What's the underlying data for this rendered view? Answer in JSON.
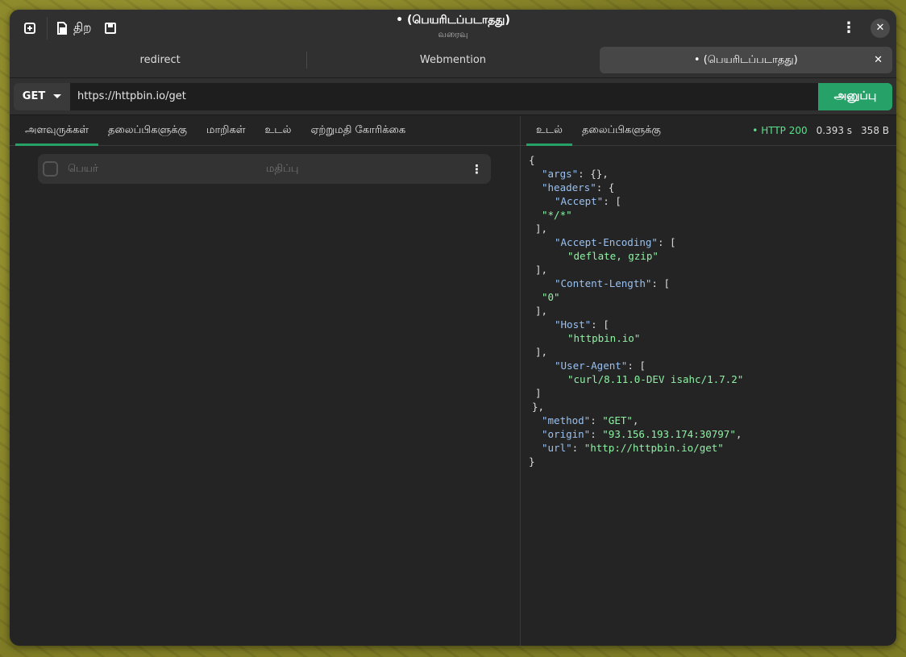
{
  "header": {
    "new_label": "",
    "open_label": "திற",
    "title": "• (பெயரிடப்படாதது)",
    "subtitle": "வரைவு"
  },
  "tabs": [
    {
      "label": "redirect",
      "active": false
    },
    {
      "label": "Webmention",
      "active": false
    },
    {
      "label": "• (பெயரிடப்படாதது)",
      "active": true
    }
  ],
  "request": {
    "method": "GET",
    "url": "https://httpbin.io/get",
    "send_label": "அனுப்பு"
  },
  "request_tabs": [
    "அளவுருக்கள்",
    "தலைப்பிகளுக்கு",
    "மாறிகள்",
    "உடல்",
    "ஏற்றுமதி கோரிக்கை"
  ],
  "params": {
    "name_placeholder": "பெயர்",
    "value_placeholder": "மதிப்பு"
  },
  "response_tabs": [
    "உடல்",
    "தலைப்பிகளுக்கு"
  ],
  "response": {
    "status": "• HTTP 200",
    "time": "0.393 s",
    "size": "358 B",
    "body_lines": [
      {
        "indent": 0,
        "parts": [
          [
            "p",
            "{"
          ]
        ]
      },
      {
        "indent": 2,
        "parts": [
          [
            "k",
            "\"args\""
          ],
          [
            "p",
            ": {},"
          ]
        ]
      },
      {
        "indent": 2,
        "parts": [
          [
            "k",
            "\"headers\""
          ],
          [
            "p",
            ": {"
          ]
        ]
      },
      {
        "indent": 4,
        "parts": [
          [
            "k",
            "\"Accept\""
          ],
          [
            "p",
            ": ["
          ]
        ]
      },
      {
        "indent": 2,
        "parts": [
          [
            "s",
            "\"*/*\""
          ]
        ]
      },
      {
        "indent": 1,
        "parts": [
          [
            "p",
            "],"
          ]
        ]
      },
      {
        "indent": 4,
        "parts": [
          [
            "k",
            "\"Accept-Encoding\""
          ],
          [
            "p",
            ": ["
          ]
        ]
      },
      {
        "indent": 6,
        "parts": [
          [
            "s",
            "\"deflate, gzip\""
          ]
        ]
      },
      {
        "indent": 1,
        "parts": [
          [
            "p",
            "],"
          ]
        ]
      },
      {
        "indent": 4,
        "parts": [
          [
            "k",
            "\"Content-Length\""
          ],
          [
            "p",
            ": ["
          ]
        ]
      },
      {
        "indent": 2,
        "parts": [
          [
            "s",
            "\"0\""
          ]
        ]
      },
      {
        "indent": 1,
        "parts": [
          [
            "p",
            "],"
          ]
        ]
      },
      {
        "indent": 4,
        "parts": [
          [
            "k",
            "\"Host\""
          ],
          [
            "p",
            ": ["
          ]
        ]
      },
      {
        "indent": 6,
        "parts": [
          [
            "s",
            "\"httpbin.io\""
          ]
        ]
      },
      {
        "indent": 1,
        "parts": [
          [
            "p",
            "],"
          ]
        ]
      },
      {
        "indent": 4,
        "parts": [
          [
            "k",
            "\"User-Agent\""
          ],
          [
            "p",
            ": ["
          ]
        ]
      },
      {
        "indent": 6,
        "parts": [
          [
            "s",
            "\"curl/8.11.0-DEV isahc/1.7.2\""
          ]
        ]
      },
      {
        "indent": 1,
        "parts": [
          [
            "p",
            "]"
          ]
        ]
      },
      {
        "indent": 0.5,
        "parts": [
          [
            "p",
            "},"
          ]
        ]
      },
      {
        "indent": 2,
        "parts": [
          [
            "k",
            "\"method\""
          ],
          [
            "p",
            ": "
          ],
          [
            "s",
            "\"GET\""
          ],
          [
            "p",
            ","
          ]
        ]
      },
      {
        "indent": 2,
        "parts": [
          [
            "k",
            "\"origin\""
          ],
          [
            "p",
            ": "
          ],
          [
            "s",
            "\"93.156.193.174:30797\""
          ],
          [
            "p",
            ","
          ]
        ]
      },
      {
        "indent": 2,
        "parts": [
          [
            "k",
            "\"url\""
          ],
          [
            "p",
            ": "
          ],
          [
            "s",
            "\"http://httpbin.io/get\""
          ]
        ]
      },
      {
        "indent": 0,
        "parts": [
          [
            "p",
            "}"
          ]
        ]
      }
    ]
  },
  "icons": {
    "new": "new-tab-icon",
    "open": "open-file-icon",
    "save": "save-icon",
    "menu": "kebab-menu-icon",
    "close": "close-icon"
  }
}
